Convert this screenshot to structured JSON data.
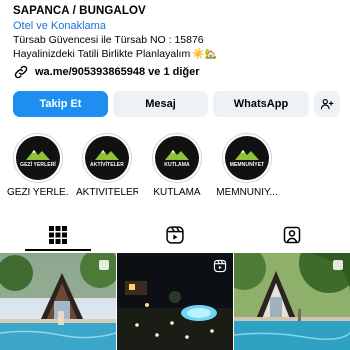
{
  "profile": {
    "name": "SAPANCA / BUNGALOV",
    "category": "Otel ve Konaklama",
    "bio_line1": "Türsab Güvencesi ile Türsab NO : 15876",
    "bio_line2": "Hayalinizdeki Tatili Birlikte Planlayalım",
    "bio_emoji": "☀️🏡",
    "link_text": "wa.me/905393865948 ve 1 diğer"
  },
  "actions": {
    "follow_label": "Takip Et",
    "message_label": "Mesaj",
    "whatsapp_label": "WhatsApp"
  },
  "highlights": [
    {
      "label": "GEZİ YERLE...",
      "inner": "GEZİ YERLERİ"
    },
    {
      "label": "AKTİVİTELER",
      "inner": "AKTİVİTELER"
    },
    {
      "label": "KUTLAMA",
      "inner": "KUTLAMA"
    },
    {
      "label": "MEMNUNİY...",
      "inner": "MEMNUNİYET"
    }
  ],
  "tabs": [
    "grid-icon",
    "reels-icon",
    "tagged-icon"
  ],
  "colors": {
    "accent": "#1e8ff0",
    "link": "#1a73c9",
    "secondary_button": "#eff2f5"
  }
}
